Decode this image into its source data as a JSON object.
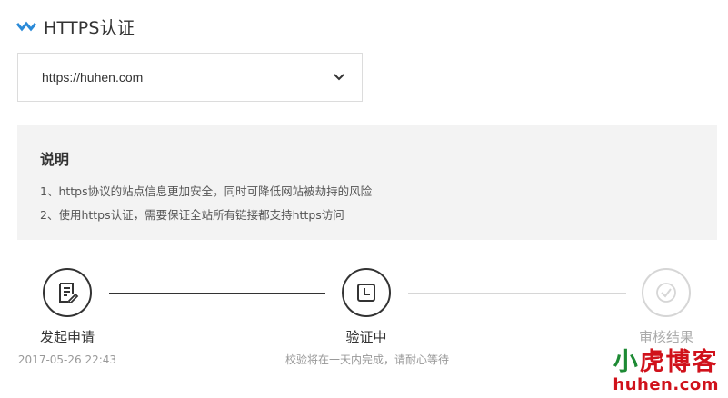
{
  "header": {
    "title": "HTTPS认证",
    "icon": "chevron-check-icon",
    "accent": "#2a8ad8"
  },
  "domain_select": {
    "value": "https://huhen.com",
    "icon": "chevron-down-icon"
  },
  "notes": {
    "title": "说明",
    "lines": [
      "1、https协议的站点信息更加安全，同时可降低网站被劫持的风险",
      "2、使用https认证，需要保证全站所有链接都支持https访问"
    ]
  },
  "steps": [
    {
      "label": "发起申请",
      "sub": "2017-05-26 22:43",
      "icon": "document-icon",
      "state": "completed"
    },
    {
      "label": "验证中",
      "sub": "校验将在一天内完成，请耐心等待",
      "icon": "clock-icon",
      "state": "active"
    },
    {
      "label": "审核结果",
      "sub": "",
      "icon": "checkmark-icon",
      "state": "pending"
    }
  ],
  "watermark": {
    "cn_part1": "小",
    "cn_part2": "虎博客",
    "en": "huhen.com",
    "colors": {
      "green": "#1d8a34",
      "red": "#d0121b"
    }
  }
}
